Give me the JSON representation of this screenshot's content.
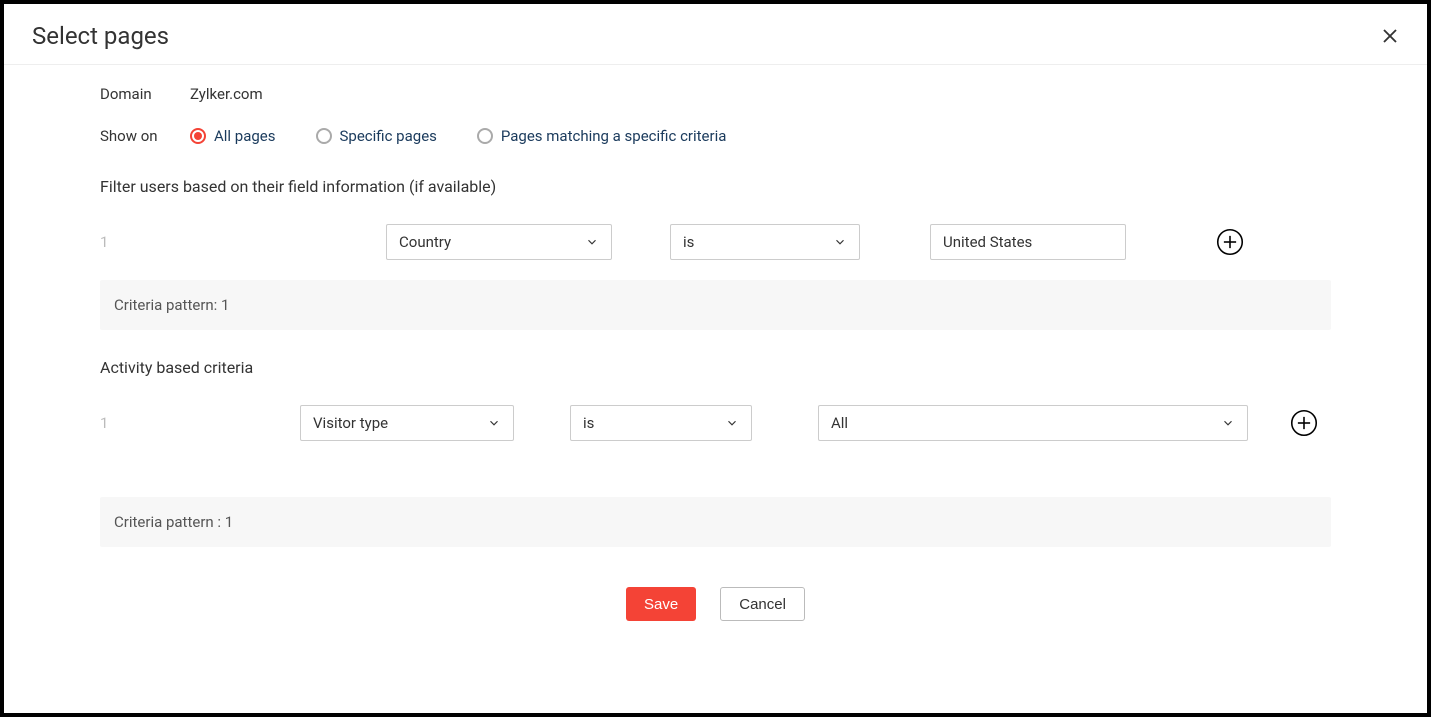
{
  "header": {
    "title": "Select pages"
  },
  "domain": {
    "label": "Domain",
    "value": "Zylker.com"
  },
  "showOn": {
    "label": "Show on",
    "options": [
      {
        "label": "All pages",
        "selected": true
      },
      {
        "label": "Specific pages",
        "selected": false
      },
      {
        "label": "Pages matching a specific criteria",
        "selected": false
      }
    ]
  },
  "filter": {
    "heading": "Filter users based on their field information (if available)",
    "rows": [
      {
        "num": "1",
        "field": "Country",
        "operator": "is",
        "value": "United States"
      }
    ],
    "pattern": "Criteria pattern: 1"
  },
  "activity": {
    "heading": "Activity based criteria",
    "rows": [
      {
        "num": "1",
        "field": "Visitor type",
        "operator": "is",
        "value": "All"
      }
    ],
    "pattern": "Criteria pattern : 1"
  },
  "footer": {
    "save": "Save",
    "cancel": "Cancel"
  }
}
